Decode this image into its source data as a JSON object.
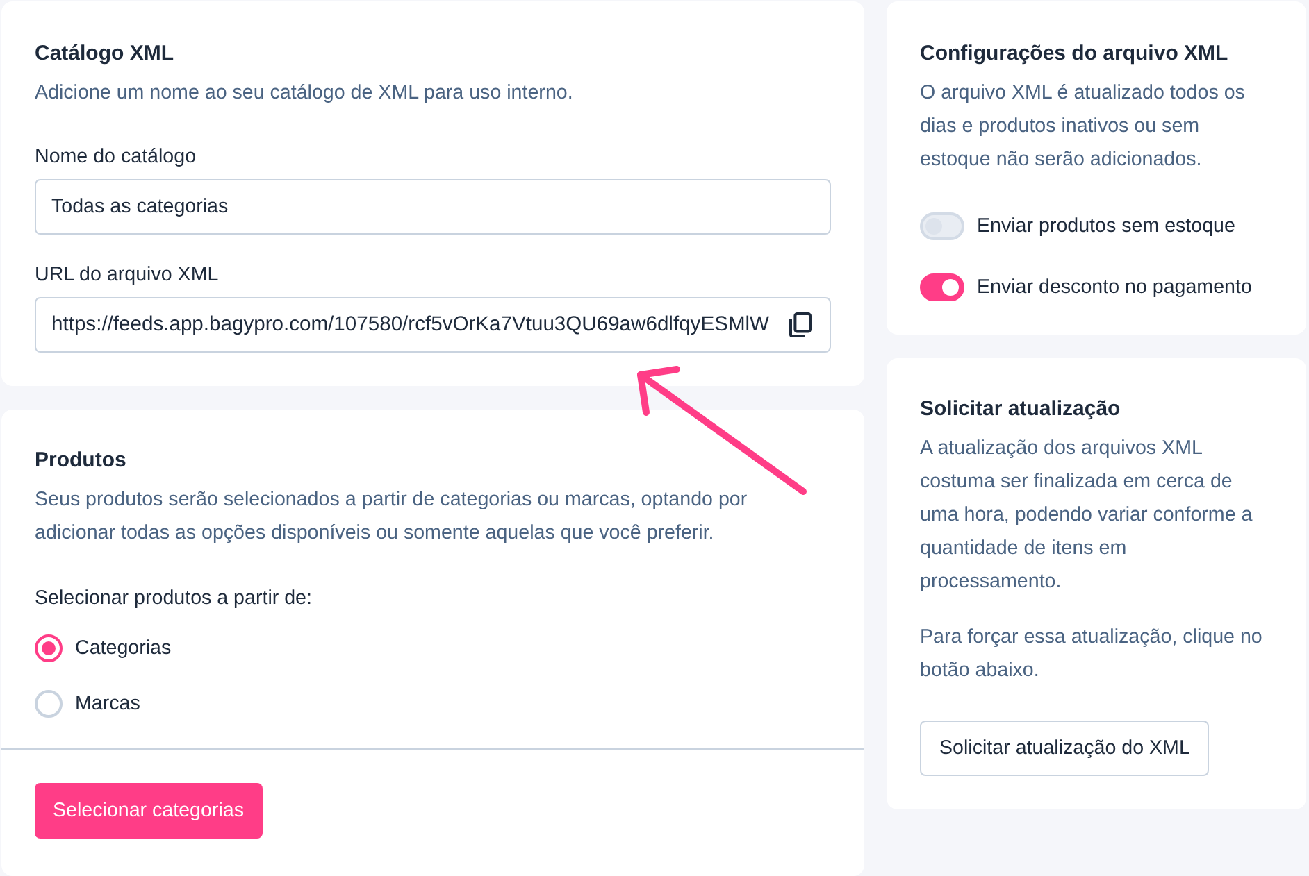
{
  "catalog_card": {
    "title": "Catálogo XML",
    "description": "Adicione um nome ao seu catálogo de XML para uso interno.",
    "name_field": {
      "label": "Nome do catálogo",
      "value": "Todas as categorias"
    },
    "url_field": {
      "label": "URL do arquivo XML",
      "value": "https://feeds.app.bagypro.com/107580/rcf5vOrKa7Vtuu3QU69aw6dlfqyESMlW"
    }
  },
  "products_card": {
    "title": "Produtos",
    "description": "Seus produtos serão selecionados a partir de categorias ou marcas, optando por adicionar todas as opções disponíveis ou somente aquelas que você preferir.",
    "choice_label": "Selecionar produtos a partir de:",
    "options": [
      {
        "label": "Categorias",
        "selected": true
      },
      {
        "label": "Marcas",
        "selected": false
      }
    ],
    "button": "Selecionar categorias"
  },
  "settings_card": {
    "title": "Configurações do arquivo XML",
    "description": "O arquivo XML é atualizado todos os dias e produtos inativos ou sem estoque não serão adicionados.",
    "toggles": [
      {
        "label": "Enviar produtos sem estoque",
        "on": false
      },
      {
        "label": "Enviar desconto no pagamento",
        "on": true
      }
    ]
  },
  "update_card": {
    "title": "Solicitar atualização",
    "paragraphs": [
      "A atualização dos arquivos XML costuma ser finalizada em cerca de uma hora, podendo variar conforme a quantidade de itens em processamento.",
      "Para forçar essa atualização, clique no botão abaixo."
    ],
    "button": "Solicitar atualização do XML"
  }
}
